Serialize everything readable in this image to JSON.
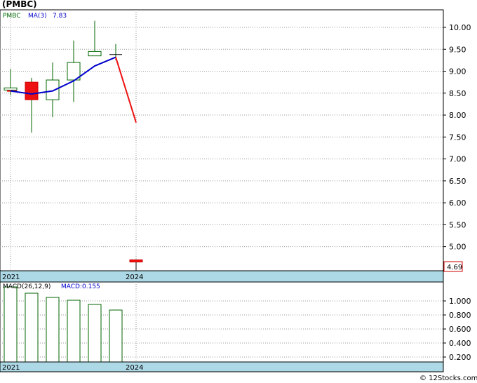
{
  "page": {
    "title": "(PMBC)",
    "watermark": "© 12Stocks.com"
  },
  "price_panel": {
    "legend_symbol": "PMBC",
    "legend_ma": "MA(3)",
    "legend_ma_value": "7.83",
    "last_price_label": "4.69",
    "x_labels": [
      "2021",
      "2024"
    ]
  },
  "macd_panel": {
    "legend_params": "MACD(26,12,9)",
    "legend_value": "MACD:0.155",
    "x_labels": [
      "2021",
      "2024"
    ]
  },
  "colors": {
    "up_candle": "#ffffff",
    "down_candle": "#ee1111",
    "candle_outline": "#006600",
    "ma_line": "#0000cc",
    "ma_drop_line": "#ee1111",
    "axis_band": "#add8e6",
    "grid": "#999999",
    "symbol_text": "#006600",
    "ma_text": "#0000cc"
  },
  "chart_data": [
    {
      "type": "candlestick",
      "title": "(PMBC)",
      "y_ticks": [
        "10.00",
        "9.50",
        "9.00",
        "8.50",
        "8.00",
        "7.50",
        "7.00",
        "6.50",
        "6.00",
        "5.50",
        "5.00"
      ],
      "ylim": [
        4.45,
        10.4
      ],
      "x_labels": [
        "2021",
        "2024"
      ],
      "candles": [
        {
          "open": 8.57,
          "close": 8.62,
          "high": 9.05,
          "low": 8.45
        },
        {
          "open": 8.75,
          "close": 8.35,
          "high": 8.85,
          "low": 7.6
        },
        {
          "open": 8.35,
          "close": 8.8,
          "high": 9.2,
          "low": 7.95
        },
        {
          "open": 8.8,
          "close": 9.2,
          "high": 9.7,
          "low": 8.3
        },
        {
          "open": 9.35,
          "close": 9.45,
          "high": 10.15,
          "low": 9.35
        },
        {
          "open": 9.38,
          "close": 9.38,
          "high": 9.62,
          "low": 9.25
        },
        {
          "open": 4.7,
          "close": 4.65,
          "high": 4.7,
          "low": 4.45
        }
      ],
      "series": [
        {
          "name": "MA(3)",
          "values": [
            8.55,
            8.48,
            8.55,
            8.78,
            9.12,
            9.32,
            7.83
          ]
        }
      ],
      "last_value": 4.69,
      "grid": true
    },
    {
      "type": "bar",
      "title": "MACD(26,12,9)",
      "y_ticks": [
        "1.000",
        "0.800",
        "0.600",
        "0.400",
        "0.200"
      ],
      "ylim": [
        0.13,
        1.27
      ],
      "x_labels": [
        "2021",
        "2024"
      ],
      "values": [
        1.2,
        1.11,
        1.05,
        1.01,
        0.95,
        0.87
      ],
      "last_value": 0.155,
      "grid": true
    }
  ]
}
